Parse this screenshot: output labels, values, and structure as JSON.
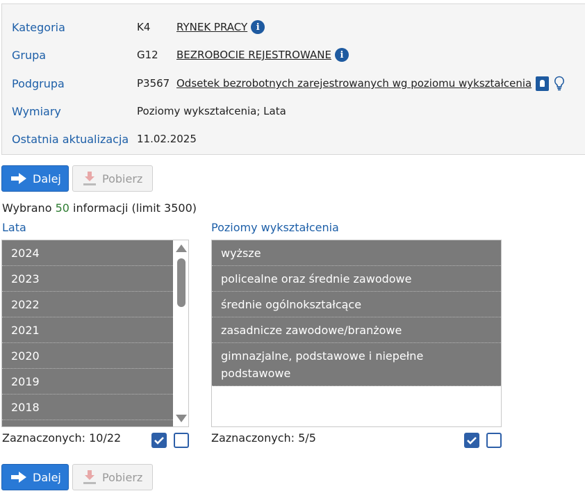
{
  "info": {
    "category": {
      "label": "Kategoria",
      "code": "K4",
      "value": "RYNEK PRACY"
    },
    "group": {
      "label": "Grupa",
      "code": "G12",
      "value": "BEZROBOCIE REJESTROWANE"
    },
    "subgroup": {
      "label": "Podgrupa",
      "code": "P3567",
      "value": "Odsetek bezrobotnych zarejestrowanych wg poziomu wykształcenia"
    },
    "dimensions": {
      "label": "Wymiary",
      "value": "Poziomy wykształcenia; Lata"
    },
    "updated": {
      "label": "Ostatnia aktualizacja",
      "value": "11.02.2025"
    }
  },
  "buttons": {
    "next": "Dalej",
    "download": "Pobierz"
  },
  "selection": {
    "prefix": "Wybrano",
    "count": "50",
    "suffix": "informacji (limit 3500)"
  },
  "years": {
    "title": "Lata",
    "items": [
      "2024",
      "2023",
      "2022",
      "2021",
      "2020",
      "2019",
      "2018"
    ],
    "counter": "Zaznaczonych: 10/22"
  },
  "education": {
    "title": "Poziomy wykształcenia",
    "items": [
      "wyższe",
      "policealne oraz średnie zawodowe",
      "średnie ogólnokształcące",
      "zasadnicze zawodowe/branżowe",
      "gimnazjalne, podstawowe i niepełne podstawowe"
    ],
    "counter": "Zaznaczonych: 5/5"
  },
  "colors": {
    "accent": "#2979d6",
    "label": "#1d5fa8",
    "item_bg": "#7a7a7a",
    "count": "#2e7d32"
  },
  "icons": [
    "info-icon",
    "book-icon",
    "lightbulb-icon",
    "arrow-right-icon",
    "download-icon"
  ]
}
